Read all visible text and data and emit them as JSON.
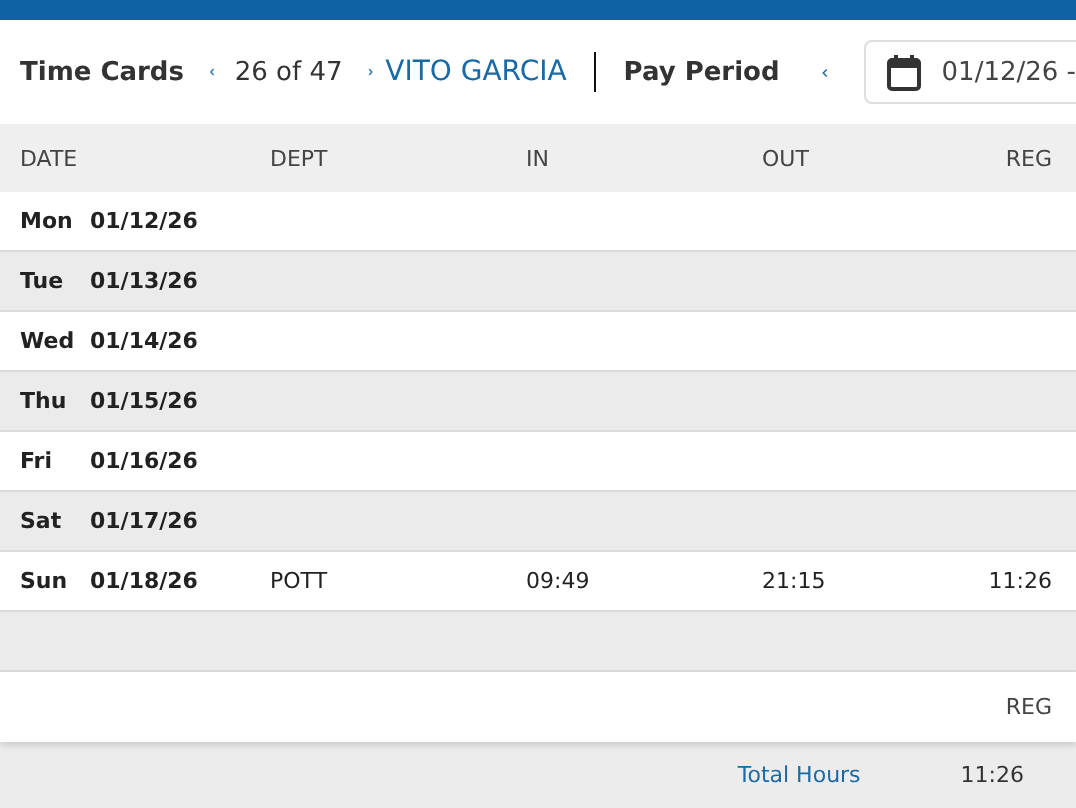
{
  "toolbar": {
    "title": "Time Cards",
    "record_position": "26 of 47",
    "employee": "VITO GARCIA",
    "pay_period_label": "Pay Period",
    "date_range": "01/12/26 -"
  },
  "table": {
    "columns": [
      "DATE",
      "DEPT",
      "IN",
      "OUT",
      "REG"
    ],
    "rows": [
      {
        "day": "Mon",
        "date": "01/12/26",
        "dept": "",
        "in": "",
        "out": "",
        "reg": ""
      },
      {
        "day": "Tue",
        "date": "01/13/26",
        "dept": "",
        "in": "",
        "out": "",
        "reg": ""
      },
      {
        "day": "Wed",
        "date": "01/14/26",
        "dept": "",
        "in": "",
        "out": "",
        "reg": ""
      },
      {
        "day": "Thu",
        "date": "01/15/26",
        "dept": "",
        "in": "",
        "out": "",
        "reg": ""
      },
      {
        "day": "Fri",
        "date": "01/16/26",
        "dept": "",
        "in": "",
        "out": "",
        "reg": ""
      },
      {
        "day": "Sat",
        "date": "01/17/26",
        "dept": "",
        "in": "",
        "out": "",
        "reg": ""
      },
      {
        "day": "Sun",
        "date": "01/18/26",
        "dept": "POTT",
        "in": "09:49",
        "out": "21:15",
        "reg": "11:26"
      }
    ]
  },
  "summary": {
    "column": "REG",
    "total_label": "Total Hours",
    "total_reg": "11:26"
  }
}
